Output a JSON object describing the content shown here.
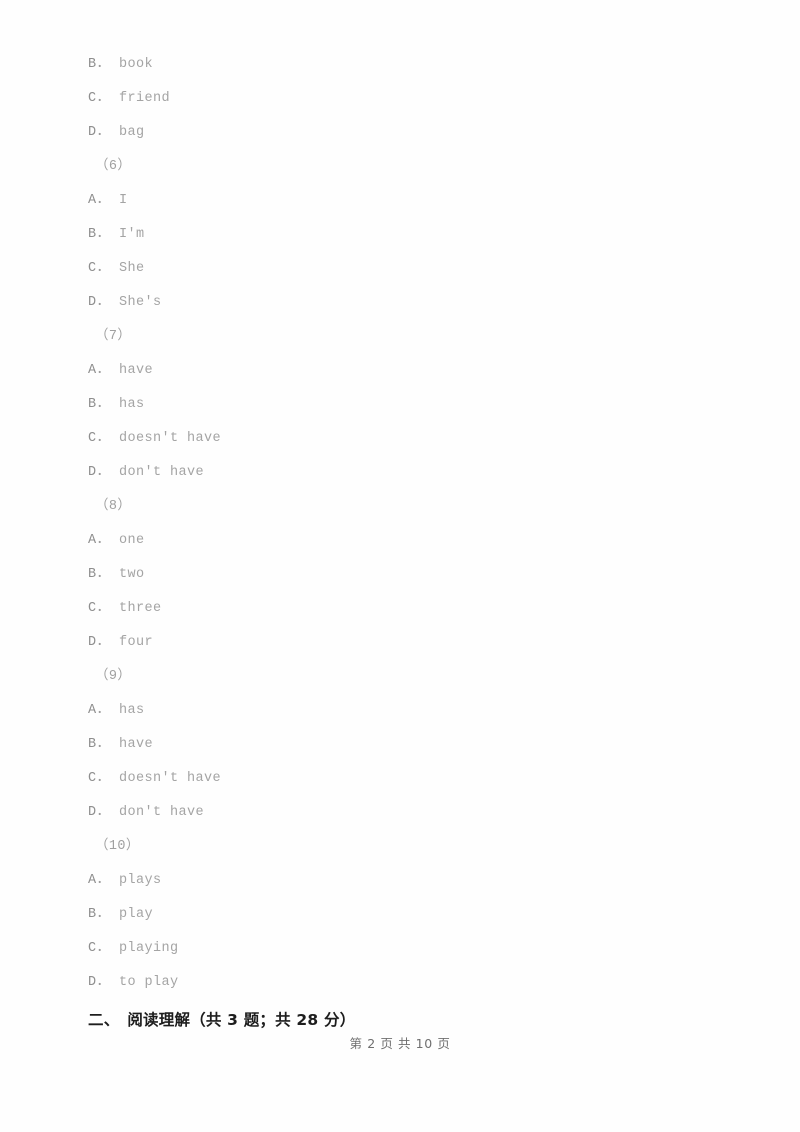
{
  "document": {
    "page_label": "第 2 页 共 10 页",
    "page_current": "2",
    "page_total": "10",
    "text_color": "#a2a2a2",
    "heading_color": "#1d1d1d",
    "footer_color": "#6f6f6f",
    "background_color": "#ffffff"
  },
  "blocks": [
    {
      "kind": "option",
      "letter": "B",
      "dot": "．",
      "text": "book"
    },
    {
      "kind": "option",
      "letter": "C",
      "dot": "．",
      "text": "friend"
    },
    {
      "kind": "option",
      "letter": "D",
      "dot": "．",
      "text": "bag"
    },
    {
      "kind": "qnum",
      "label": "（6）"
    },
    {
      "kind": "option",
      "letter": "A",
      "dot": "．",
      "text": "I"
    },
    {
      "kind": "option",
      "letter": "B",
      "dot": "．",
      "text": "I'm"
    },
    {
      "kind": "option",
      "letter": "C",
      "dot": "．",
      "text": "She"
    },
    {
      "kind": "option",
      "letter": "D",
      "dot": "．",
      "text": "She's"
    },
    {
      "kind": "qnum",
      "label": "（7）"
    },
    {
      "kind": "option",
      "letter": "A",
      "dot": "．",
      "text": "have"
    },
    {
      "kind": "option",
      "letter": "B",
      "dot": "．",
      "text": "has"
    },
    {
      "kind": "option",
      "letter": "C",
      "dot": "．",
      "text": "doesn't have"
    },
    {
      "kind": "option",
      "letter": "D",
      "dot": "．",
      "text": "don't have"
    },
    {
      "kind": "qnum",
      "label": "（8）"
    },
    {
      "kind": "option",
      "letter": "A",
      "dot": "．",
      "text": "one"
    },
    {
      "kind": "option",
      "letter": "B",
      "dot": "．",
      "text": "two"
    },
    {
      "kind": "option",
      "letter": "C",
      "dot": "．",
      "text": "three"
    },
    {
      "kind": "option",
      "letter": "D",
      "dot": "．",
      "text": "four"
    },
    {
      "kind": "qnum",
      "label": "（9）"
    },
    {
      "kind": "option",
      "letter": "A",
      "dot": "．",
      "text": "has"
    },
    {
      "kind": "option",
      "letter": "B",
      "dot": "．",
      "text": "have"
    },
    {
      "kind": "option",
      "letter": "C",
      "dot": "．",
      "text": "doesn't have"
    },
    {
      "kind": "option",
      "letter": "D",
      "dot": "．",
      "text": "don't have"
    },
    {
      "kind": "qnum",
      "label": "（10）"
    },
    {
      "kind": "option",
      "letter": "A",
      "dot": "．",
      "text": "plays"
    },
    {
      "kind": "option",
      "letter": "B",
      "dot": "．",
      "text": "play"
    },
    {
      "kind": "option",
      "letter": "C",
      "dot": "．",
      "text": "playing"
    },
    {
      "kind": "option",
      "letter": "D",
      "dot": "．",
      "text": "to play"
    }
  ],
  "section": {
    "number": "二、",
    "title": "阅读理解",
    "meta": "（共 3 题；共 28 分）",
    "full_text": "二、　阅读理解（共 3 题；共 28 分）"
  }
}
